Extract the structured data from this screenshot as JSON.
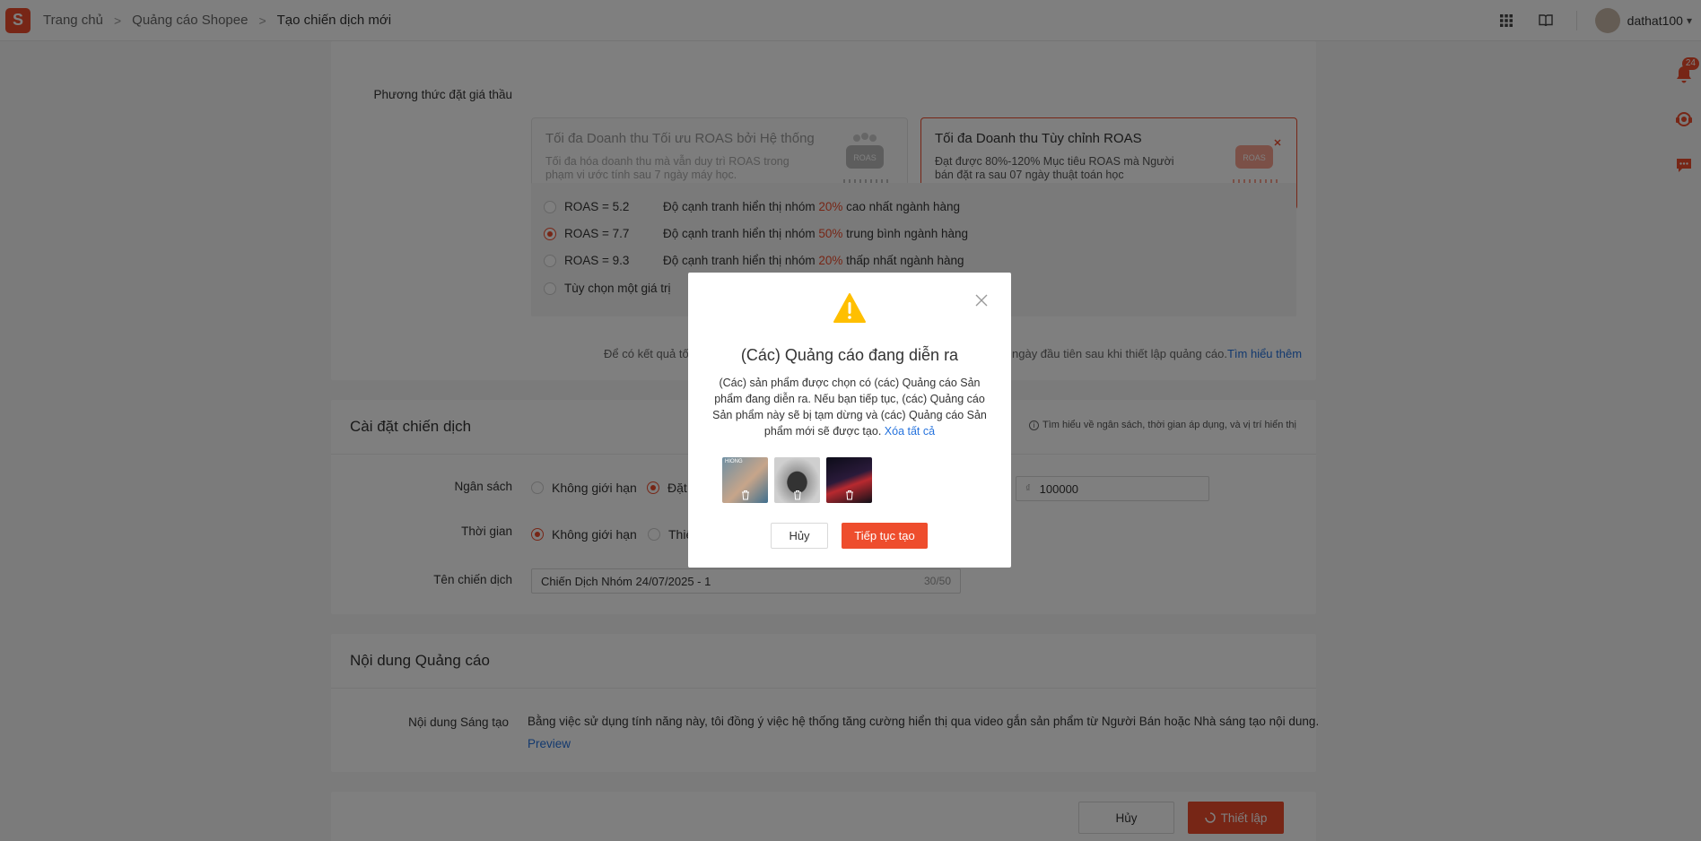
{
  "topbar": {
    "logo_text": "S",
    "breadcrumbs": [
      "Trang chủ",
      "Quảng cáo Shopee",
      "Tạo chiến dịch mới"
    ],
    "username": "dathat100",
    "notification_count": "24"
  },
  "bidding": {
    "label": "Phương thức đặt giá thầu",
    "option_system": {
      "title": "Tối đa Doanh thu Tối ưu ROAS bởi Hệ thống",
      "desc": "Tối đa hóa doanh thu mà vẫn duy trì ROAS trong phạm vi ước tính sau 7 ngày máy học."
    },
    "option_custom": {
      "title": "Tối đa Doanh thu Tùy chỉnh ROAS",
      "desc": "Đạt được 80%-120% Mục tiêu ROAS mà Người bán đặt ra sau 07 ngày thuật toán học"
    },
    "roas_options": [
      {
        "label": "ROAS = 5.2",
        "desc_pre": "Độ cạnh tranh hiển thị nhóm ",
        "pct": "20%",
        "desc_post": " cao nhất ngành hàng",
        "selected": false
      },
      {
        "label": "ROAS = 7.7",
        "desc_pre": "Độ cạnh tranh hiển thị nhóm ",
        "pct": "50%",
        "desc_post": " trung bình ngành hàng",
        "selected": true
      },
      {
        "label": "ROAS = 9.3",
        "desc_pre": "Độ cạnh tranh hiển thị nhóm ",
        "pct": "20%",
        "desc_post": " thấp nhất ngành hàng",
        "selected": false
      }
    ],
    "custom_value_label": "Tùy chọn một giá trị",
    "note_left": "Để có kết quả tốt",
    "note_right": "ngày đầu tiên sau khi thiết lập quảng cáo.",
    "note_link": "Tìm hiểu thêm"
  },
  "campaign_settings": {
    "title": "Cài đặt chiến dịch",
    "info": "Tìm hiểu về ngân sách, thời gian áp dụng, và vị trí hiển thị",
    "budget_label": "Ngân sách",
    "budget_unlimited": "Không giới hạn",
    "budget_set": "Đặt",
    "currency": "₫",
    "budget_value": "100000",
    "time_label": "Thời gian",
    "time_unlimited": "Không giới hạn",
    "time_set": "Thiế",
    "name_label": "Tên chiến dịch",
    "name_value": "Chiến Dịch Nhóm 24/07/2025 - 1",
    "name_counter": "30/50"
  },
  "ad_content": {
    "title": "Nội dung Quảng cáo",
    "creative_label": "Nội dung Sáng tạo",
    "creative_text": "Bằng việc sử dụng tính năng này, tôi đồng ý việc hệ thống tăng cường hiển thị qua video gắn sản phẩm từ Người Bán hoặc Nhà sáng tạo nội dung.",
    "preview_link": "Preview"
  },
  "footer": {
    "cancel": "Hủy",
    "submit": "Thiết lập"
  },
  "modal": {
    "title": "(Các) Quảng cáo đang diễn ra",
    "body": "(Các) sản phẩm được chọn có (các) Quảng cáo Sản phẩm đang diễn ra. Nếu bạn tiếp tục, (các) Quảng cáo Sản phẩm này sẽ bị tạm dừng và (các) Quảng cáo Sản phẩm mới sẽ được tạo.",
    "clear_all": "Xóa tất cả",
    "cancel": "Hủy",
    "continue": "Tiếp tục tạo",
    "thumb_text": "HIONG"
  },
  "colors": {
    "accent": "#ee4d2d",
    "link": "#2673dd",
    "warning": "#ffbf00"
  }
}
